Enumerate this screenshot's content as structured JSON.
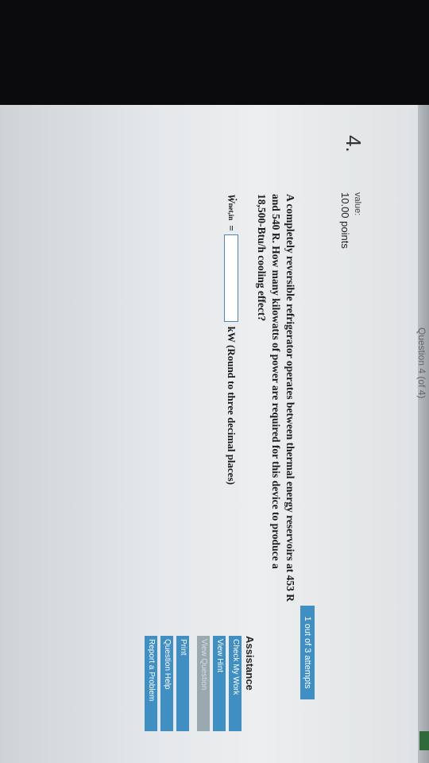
{
  "header": {
    "question_nav": "Question 4 (of 4)"
  },
  "question": {
    "number": "4.",
    "value_label": "value:",
    "points": "10.00 points",
    "attempts": "1 out of 3 attempts",
    "text_lines": [
      "A completely reversible refrigerator operates between thermal energy reservoirs at  453 R",
      "and 540 R. How many kilowatts of power are required for this device to produce a",
      "18,500-Btu/h  cooling effect?"
    ],
    "answer": {
      "symbol": "Ẇ",
      "subscript": "net,in",
      "equals": "=",
      "value": "",
      "unit": "kW (Round to three decimal places)"
    }
  },
  "assistance": {
    "title": "Assistance",
    "buttons": [
      "Check My Work",
      "View Hint",
      "View Question"
    ],
    "links": [
      "Print",
      "Question Help",
      "Report a Problem"
    ]
  }
}
